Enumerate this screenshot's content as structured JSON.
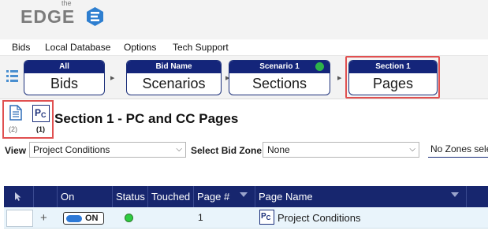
{
  "app": {
    "logo_small": "the",
    "logo_text": "EDGE"
  },
  "menu": {
    "items": [
      {
        "label": "Bids"
      },
      {
        "label": "Local Database"
      },
      {
        "label": "Options"
      },
      {
        "label": "Tech Support"
      }
    ]
  },
  "breadcrumbs": [
    {
      "top": "All",
      "bottom": "Bids"
    },
    {
      "top": "Bid Name",
      "bottom": "Scenarios"
    },
    {
      "top": "Scenario 1",
      "bottom": "Sections",
      "icon": "user-icon"
    },
    {
      "top": "Section 1",
      "bottom": "Pages"
    }
  ],
  "page_icons": {
    "doc_count": "(2)",
    "pc_label": "P",
    "pc_sub": "C",
    "pc_count": "(1)"
  },
  "title": "Section 1 - PC and CC Pages",
  "filters": {
    "view_label": "View",
    "view_value": "Project Conditions",
    "zone_label": "Select Bid Zone",
    "zone_value": "None",
    "no_zones_text": "No Zones sele"
  },
  "table": {
    "headers": {
      "on": "On",
      "status": "Status",
      "touched": "Touched",
      "page_num": "Page #",
      "page_name": "Page Name"
    },
    "rows": [
      {
        "toggle": "ON",
        "status": "green",
        "page_num": "1",
        "icon_label": "P",
        "icon_sub": "C",
        "page_name": "Project Conditions"
      }
    ]
  },
  "colors": {
    "navy": "#17266e",
    "highlight_red": "#e05050",
    "status_green": "#2ecc40",
    "toggle_blue": "#2d79d6"
  }
}
